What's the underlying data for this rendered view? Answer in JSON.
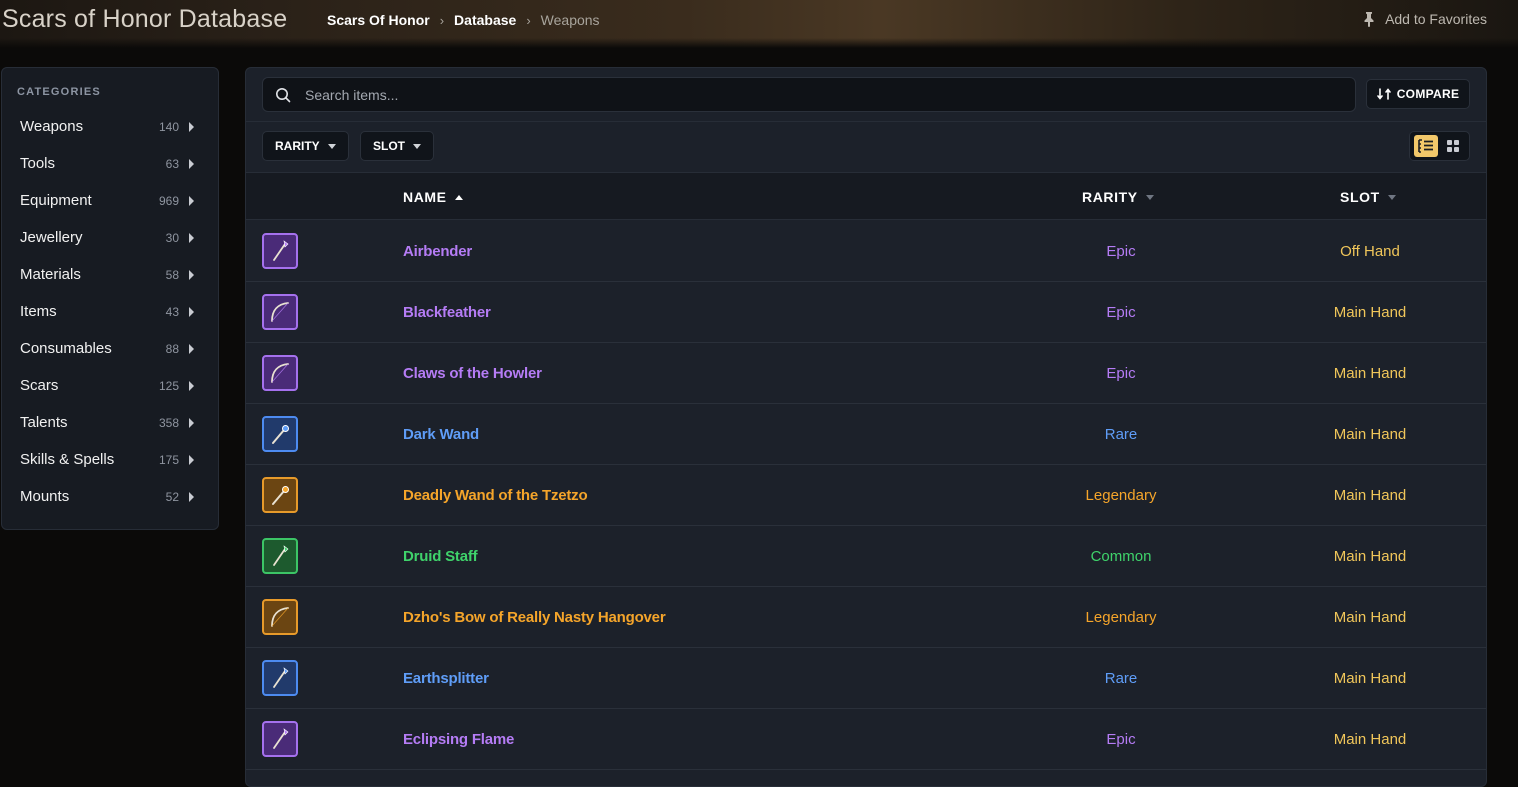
{
  "site": {
    "title": "Scars of Honor Database",
    "favorites_label": "Add to Favorites"
  },
  "breadcrumb": [
    "Scars Of Honor",
    "Database",
    "Weapons"
  ],
  "sidebar": {
    "title": "CATEGORIES",
    "items": [
      {
        "label": "Weapons",
        "count": "140"
      },
      {
        "label": "Tools",
        "count": "63"
      },
      {
        "label": "Equipment",
        "count": "969"
      },
      {
        "label": "Jewellery",
        "count": "30"
      },
      {
        "label": "Materials",
        "count": "58"
      },
      {
        "label": "Items",
        "count": "43"
      },
      {
        "label": "Consumables",
        "count": "88"
      },
      {
        "label": "Scars",
        "count": "125"
      },
      {
        "label": "Talents",
        "count": "358"
      },
      {
        "label": "Skills & Spells",
        "count": "175"
      },
      {
        "label": "Mounts",
        "count": "52"
      }
    ]
  },
  "search": {
    "placeholder": "Search items..."
  },
  "toolbar": {
    "compare_label": "COMPARE",
    "filter_rarity": "RARITY",
    "filter_slot": "SLOT",
    "active_view": "list"
  },
  "table": {
    "columns": {
      "name": "NAME",
      "rarity": "RARITY",
      "slot": "SLOT"
    },
    "rows": [
      {
        "name": "Airbender",
        "rarity": "Epic",
        "slot": "Off Hand",
        "icon": "staff-icon"
      },
      {
        "name": "Blackfeather",
        "rarity": "Epic",
        "slot": "Main Hand",
        "icon": "bow-icon"
      },
      {
        "name": "Claws of the Howler",
        "rarity": "Epic",
        "slot": "Main Hand",
        "icon": "bow-icon"
      },
      {
        "name": "Dark Wand",
        "rarity": "Rare",
        "slot": "Main Hand",
        "icon": "wand-icon"
      },
      {
        "name": "Deadly Wand of the Tzetzo",
        "rarity": "Legendary",
        "slot": "Main Hand",
        "icon": "wand-icon"
      },
      {
        "name": "Druid Staff",
        "rarity": "Common",
        "slot": "Main Hand",
        "icon": "staff-icon"
      },
      {
        "name": "Dzho's Bow of Really Nasty Hangover",
        "rarity": "Legendary",
        "slot": "Main Hand",
        "icon": "bow-icon"
      },
      {
        "name": "Earthsplitter",
        "rarity": "Rare",
        "slot": "Main Hand",
        "icon": "staff-icon"
      },
      {
        "name": "Eclipsing Flame",
        "rarity": "Epic",
        "slot": "Main Hand",
        "icon": "staff-icon"
      }
    ]
  },
  "colors": {
    "Epic": "#b57cf5",
    "Rare": "#5f9df7",
    "Legendary": "#f5a52a",
    "Common": "#3fd36b",
    "slot": "#f0c65a",
    "accent": "#f2c86a",
    "icon_bg": {
      "Epic": "#4a2b78",
      "Rare": "#213a6b",
      "Legendary": "#6b4512",
      "Common": "#1d5a2e"
    },
    "icon_border": {
      "Epic": "#a571ee",
      "Rare": "#4d8bf0",
      "Legendary": "#e79a2a",
      "Common": "#3cc566"
    }
  }
}
